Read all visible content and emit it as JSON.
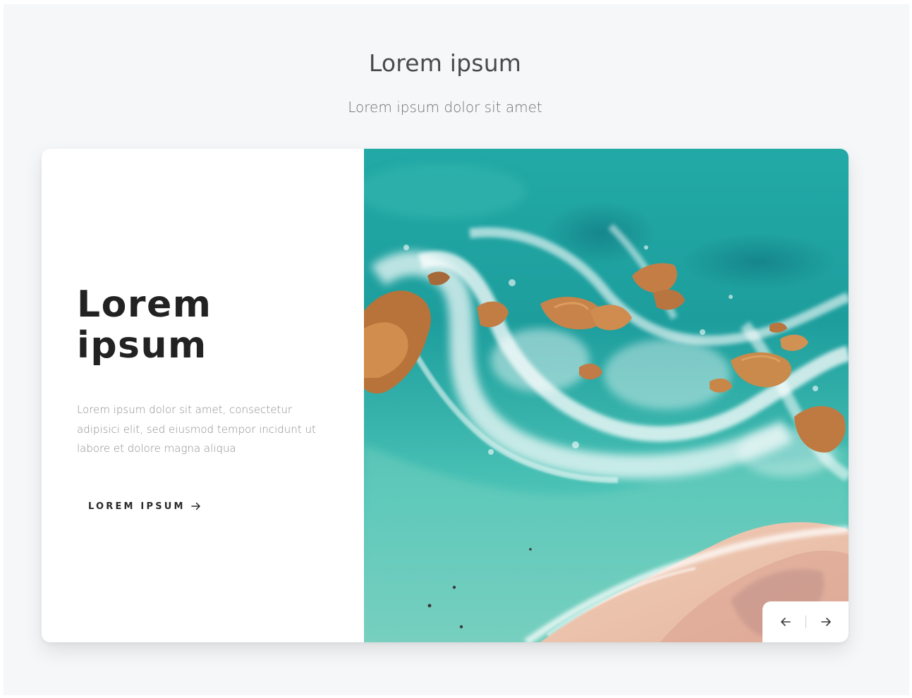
{
  "header": {
    "title": "Lorem ipsum",
    "subtitle": "Lorem ipsum dolor sit amet"
  },
  "slide": {
    "title": "Lorem ipsum",
    "text": "Lorem ipsum dolor sit amet, consectetur adipisici elit, sed eiusmod tempor incidunt ut labore et dolore magna aliqua",
    "cta_label": "LOREM IPSUM",
    "cta_icon": "arrow-right-icon",
    "image_alt": "aerial-beach-photo"
  },
  "navigation": {
    "prev_icon": "arrow-left-icon",
    "next_icon": "arrow-right-icon"
  },
  "colors": {
    "background": "#f6f7f9",
    "card": "#ffffff",
    "title": "#222222",
    "text": "#8d8d8d",
    "sea": "#2fb3ad",
    "sand": "#e9c2ad",
    "rock": "#c98a4b"
  }
}
